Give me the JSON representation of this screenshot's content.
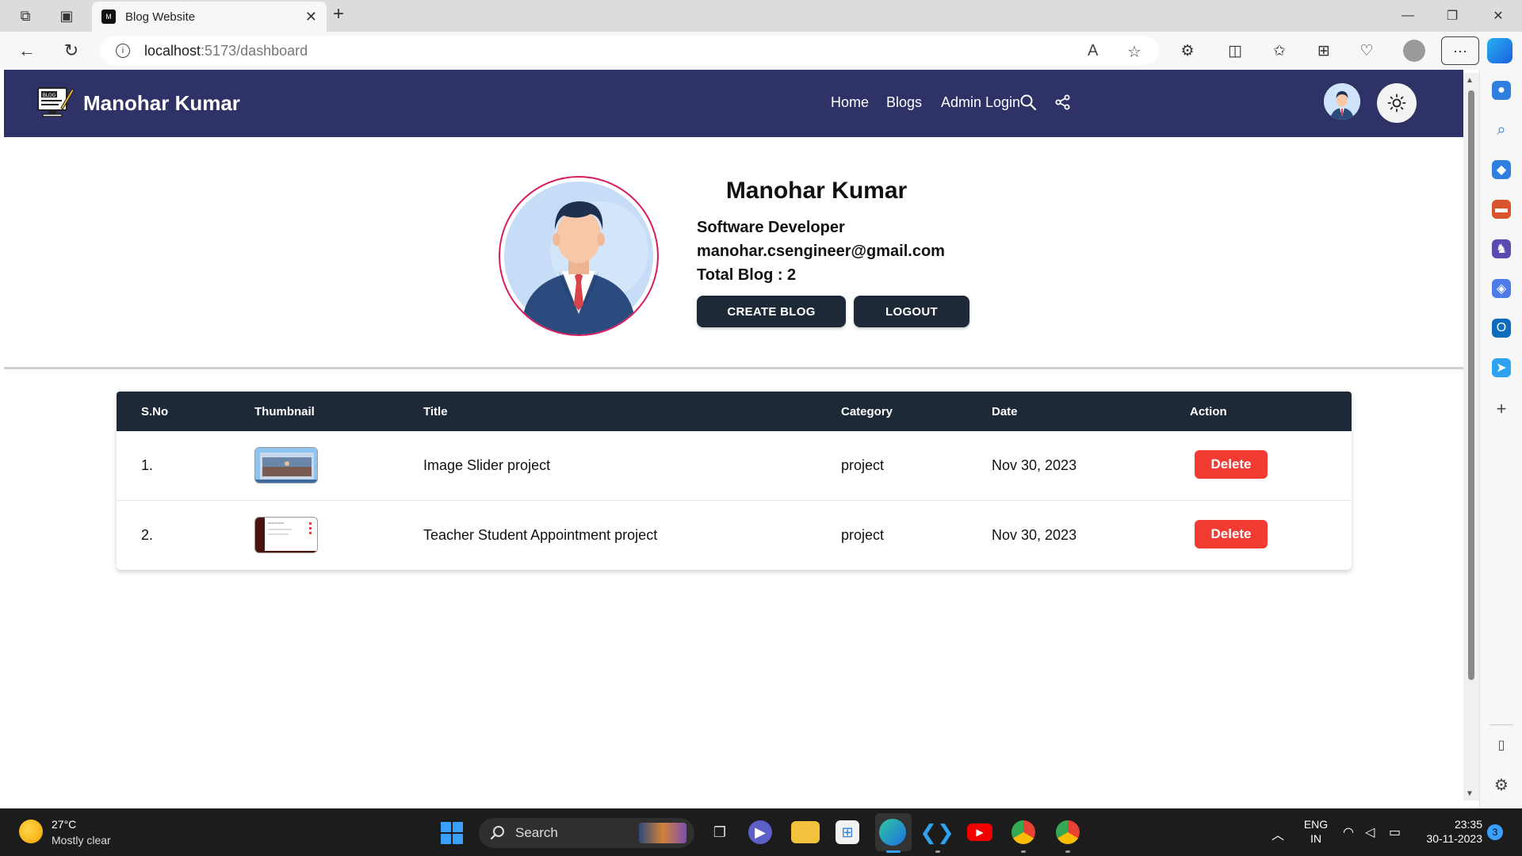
{
  "browser": {
    "tab_title": "Blog Website",
    "tab_favicon_text": "M",
    "url_host": "localhost",
    "url_path": ":5173/dashboard"
  },
  "site": {
    "brand": "Manohar Kumar",
    "logo_text": "BLOG",
    "nav": {
      "home": "Home",
      "blogs": "Blogs",
      "admin_login": "Admin Login"
    }
  },
  "profile": {
    "name": "Manohar Kumar",
    "role": "Software Developer",
    "email": "manohar.csengineer@gmail.com",
    "total_blog": "Total Blog : 2",
    "create_label": "CREATE BLOG",
    "logout_label": "LOGOUT"
  },
  "table": {
    "headers": [
      "S.No",
      "Thumbnail",
      "Title",
      "Category",
      "Date",
      "Action"
    ],
    "rows": [
      {
        "sno": "1.",
        "title": "Image Slider project",
        "category": "project",
        "date": "Nov 30, 2023",
        "action": "Delete"
      },
      {
        "sno": "2.",
        "title": "Teacher Student Appointment project",
        "category": "project",
        "date": "Nov 30, 2023",
        "action": "Delete"
      }
    ]
  },
  "taskbar": {
    "temperature": "27°C",
    "weather": "Mostly clear",
    "search_label": "Search",
    "lang": "ENG",
    "region": "IN",
    "time": "23:35",
    "date": "30-11-2023",
    "notifications": "3"
  },
  "colors": {
    "navbar": "#2e3266",
    "table_header": "#1e2937",
    "delete": "#f23c33",
    "avatar_ring": "#d81b60"
  }
}
